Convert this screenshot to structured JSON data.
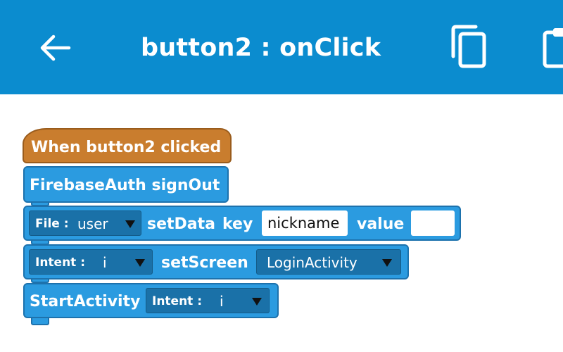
{
  "appbar": {
    "title": "button2 : onClick",
    "icons": {
      "back": "arrow-back-icon",
      "copy": "copy-icon",
      "paste": "paste-icon"
    },
    "background": "#0b8ccf"
  },
  "blocks": {
    "event": {
      "label": "When button2 clicked",
      "color": "#c97d2e"
    },
    "signout": {
      "label": "FirebaseAuth signOut"
    },
    "setdata": {
      "file_type": "File :",
      "file_value": "user",
      "label_setdata": "setData",
      "label_key": "key",
      "key_value": "nickname",
      "label_value": "value",
      "value_value": ""
    },
    "setscreen": {
      "intent_type": "Intent :",
      "intent_value": "i",
      "label": "setScreen",
      "screen_value": "LoginActivity"
    },
    "startactivity": {
      "label": "StartActivity",
      "intent_type": "Intent :",
      "intent_value": "i"
    },
    "command_color": "#2b9be0"
  }
}
